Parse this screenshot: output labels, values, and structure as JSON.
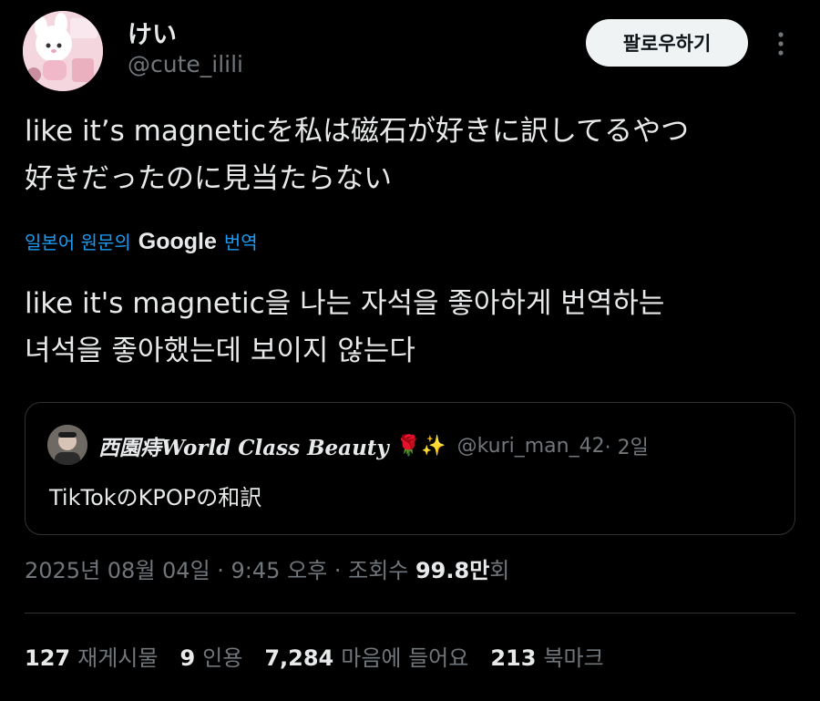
{
  "author": {
    "name": "けい",
    "handle": "@cute_ilili"
  },
  "follow_label": "팔로우하기",
  "more_icon": "more-vertical-icon",
  "tweet": {
    "line1": "like it’s magneticを私は磁石が好きに訳してるやつ",
    "line2": "好きだったのに見当たらない"
  },
  "translation": {
    "prefix": "일본어 원문의",
    "provider": "Google",
    "suffix": "번역",
    "line1": "like it's magnetic을 나는 자석을 좋아하게 번역하는",
    "line2": "녀석을 좋아했는데 보이지 않는다"
  },
  "quote": {
    "name": "西園痔World Class Beauty",
    "emoji": "🌹✨",
    "handle": "@kuri_man_42",
    "time": " · 2일",
    "text": "TikTokのKPOPの和訳"
  },
  "meta": {
    "datetime": "2025년 08월 04일 · 9:45 오후 · 조회수 ",
    "views_number": "99.8만",
    "views_suffix": "회"
  },
  "stats": {
    "reposts_count": "127",
    "reposts_label": "재게시물",
    "quotes_count": "9",
    "quotes_label": "인용",
    "likes_count": "7,284",
    "likes_label": "마음에 들어요",
    "bookmarks_count": "213",
    "bookmarks_label": "북마크"
  },
  "colors": {
    "background": "#000000",
    "text": "#e7e9ea",
    "secondary": "#71767b",
    "link": "#1d9bf0",
    "border": "#2f3336"
  }
}
